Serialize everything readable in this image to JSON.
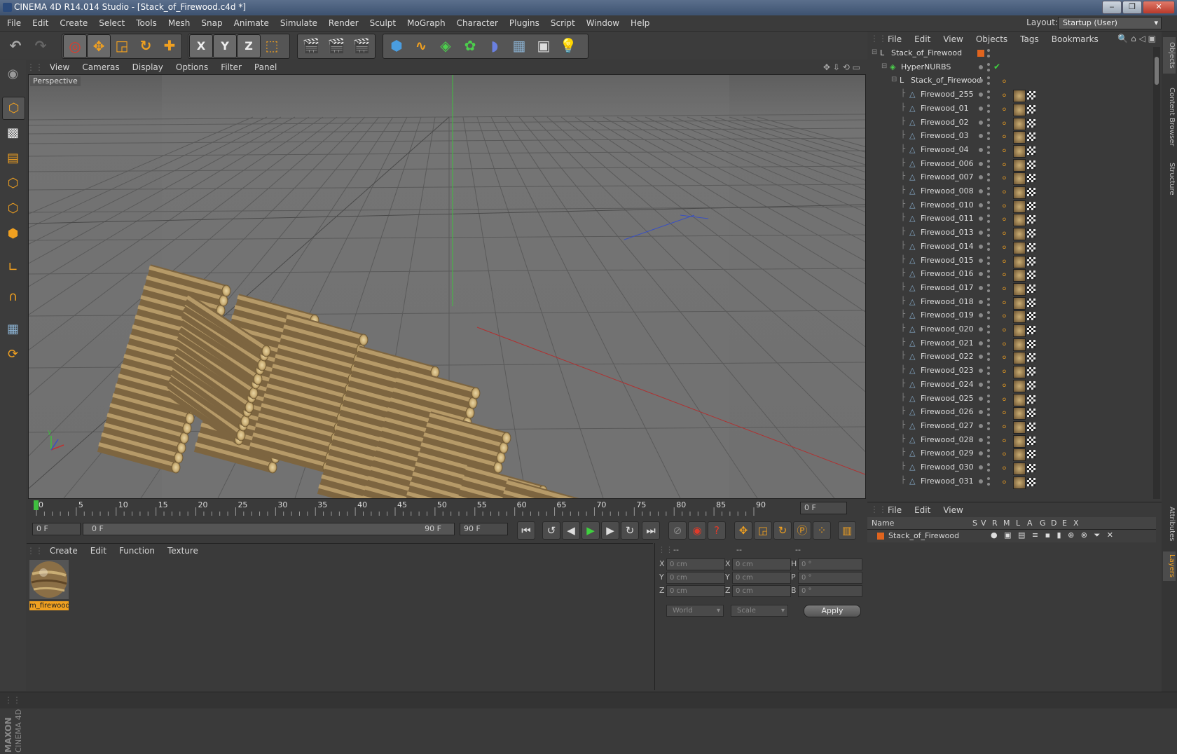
{
  "window": {
    "title": "CINEMA 4D R14.014 Studio - [Stack_of_Firewood.c4d *]",
    "minimize": "‒",
    "maximize": "❐",
    "close": "✕"
  },
  "menubar": {
    "items": [
      "File",
      "Edit",
      "Create",
      "Select",
      "Tools",
      "Mesh",
      "Snap",
      "Animate",
      "Simulate",
      "Render",
      "Sculpt",
      "MoGraph",
      "Character",
      "Plugins",
      "Script",
      "Window",
      "Help"
    ],
    "layout_label": "Layout:",
    "layout_value": "Startup (User)"
  },
  "toolbar": {
    "x_label": "X",
    "y_label": "Y",
    "z_label": "Z"
  },
  "viewport": {
    "menu": [
      "View",
      "Cameras",
      "Display",
      "Options",
      "Filter",
      "Panel"
    ],
    "label": "Perspective"
  },
  "timeline": {
    "ticks": [
      "0",
      "5",
      "10",
      "15",
      "20",
      "25",
      "30",
      "35",
      "40",
      "45",
      "50",
      "55",
      "60",
      "65",
      "70",
      "75",
      "80",
      "85",
      "90"
    ],
    "current": "0 F"
  },
  "transport": {
    "start": "0 F",
    "range_start": "0 F",
    "range_end": "90 F",
    "end": "90 F"
  },
  "material_manager": {
    "menu": [
      "Create",
      "Edit",
      "Function",
      "Texture"
    ],
    "material_name": "m_firewood"
  },
  "coordinates": {
    "header": [
      "--",
      "--",
      "--"
    ],
    "rows": [
      {
        "a": "X",
        "av": "0 cm",
        "b": "X",
        "bv": "0 cm",
        "c": "H",
        "cv": "0 °"
      },
      {
        "a": "Y",
        "av": "0 cm",
        "b": "Y",
        "bv": "0 cm",
        "c": "P",
        "cv": "0 °"
      },
      {
        "a": "Z",
        "av": "0 cm",
        "b": "Z",
        "bv": "0 cm",
        "c": "B",
        "cv": "0 °"
      }
    ],
    "space": "World",
    "mode": "Scale",
    "apply": "Apply"
  },
  "object_manager": {
    "menu": [
      "File",
      "Edit",
      "View",
      "Objects",
      "Tags",
      "Bookmarks"
    ],
    "objects": [
      {
        "name": "Stack_of_Firewood",
        "level": 0,
        "kind": "null"
      },
      {
        "name": "HyperNURBS",
        "level": 1,
        "kind": "nurbs"
      },
      {
        "name": "Stack_of_Firewood",
        "level": 2,
        "kind": "null"
      },
      {
        "name": "Firewood_255",
        "level": 3,
        "kind": "mesh"
      },
      {
        "name": "Firewood_01",
        "level": 3,
        "kind": "mesh"
      },
      {
        "name": "Firewood_02",
        "level": 3,
        "kind": "mesh"
      },
      {
        "name": "Firewood_03",
        "level": 3,
        "kind": "mesh"
      },
      {
        "name": "Firewood_04",
        "level": 3,
        "kind": "mesh"
      },
      {
        "name": "Firewood_006",
        "level": 3,
        "kind": "mesh"
      },
      {
        "name": "Firewood_007",
        "level": 3,
        "kind": "mesh"
      },
      {
        "name": "Firewood_008",
        "level": 3,
        "kind": "mesh"
      },
      {
        "name": "Firewood_010",
        "level": 3,
        "kind": "mesh"
      },
      {
        "name": "Firewood_011",
        "level": 3,
        "kind": "mesh"
      },
      {
        "name": "Firewood_013",
        "level": 3,
        "kind": "mesh"
      },
      {
        "name": "Firewood_014",
        "level": 3,
        "kind": "mesh"
      },
      {
        "name": "Firewood_015",
        "level": 3,
        "kind": "mesh"
      },
      {
        "name": "Firewood_016",
        "level": 3,
        "kind": "mesh"
      },
      {
        "name": "Firewood_017",
        "level": 3,
        "kind": "mesh"
      },
      {
        "name": "Firewood_018",
        "level": 3,
        "kind": "mesh"
      },
      {
        "name": "Firewood_019",
        "level": 3,
        "kind": "mesh"
      },
      {
        "name": "Firewood_020",
        "level": 3,
        "kind": "mesh"
      },
      {
        "name": "Firewood_021",
        "level": 3,
        "kind": "mesh"
      },
      {
        "name": "Firewood_022",
        "level": 3,
        "kind": "mesh"
      },
      {
        "name": "Firewood_023",
        "level": 3,
        "kind": "mesh"
      },
      {
        "name": "Firewood_024",
        "level": 3,
        "kind": "mesh"
      },
      {
        "name": "Firewood_025",
        "level": 3,
        "kind": "mesh"
      },
      {
        "name": "Firewood_026",
        "level": 3,
        "kind": "mesh"
      },
      {
        "name": "Firewood_027",
        "level": 3,
        "kind": "mesh"
      },
      {
        "name": "Firewood_028",
        "level": 3,
        "kind": "mesh"
      },
      {
        "name": "Firewood_029",
        "level": 3,
        "kind": "mesh"
      },
      {
        "name": "Firewood_030",
        "level": 3,
        "kind": "mesh"
      },
      {
        "name": "Firewood_031",
        "level": 3,
        "kind": "mesh"
      }
    ]
  },
  "layer_manager": {
    "menu": [
      "File",
      "Edit",
      "View"
    ],
    "columns": [
      "Name",
      "S",
      "V",
      "R",
      "M",
      "L",
      "A",
      "G",
      "D",
      "E",
      "X"
    ],
    "layer_name": "Stack_of_Firewood"
  },
  "right_tabs": [
    "Objects",
    "Content Browser",
    "Structure",
    "Attributes",
    "Layers"
  ],
  "colors": {
    "accent": "#f0a020",
    "layer": "#e0641e",
    "selected_frame": "#3fbf3f"
  }
}
